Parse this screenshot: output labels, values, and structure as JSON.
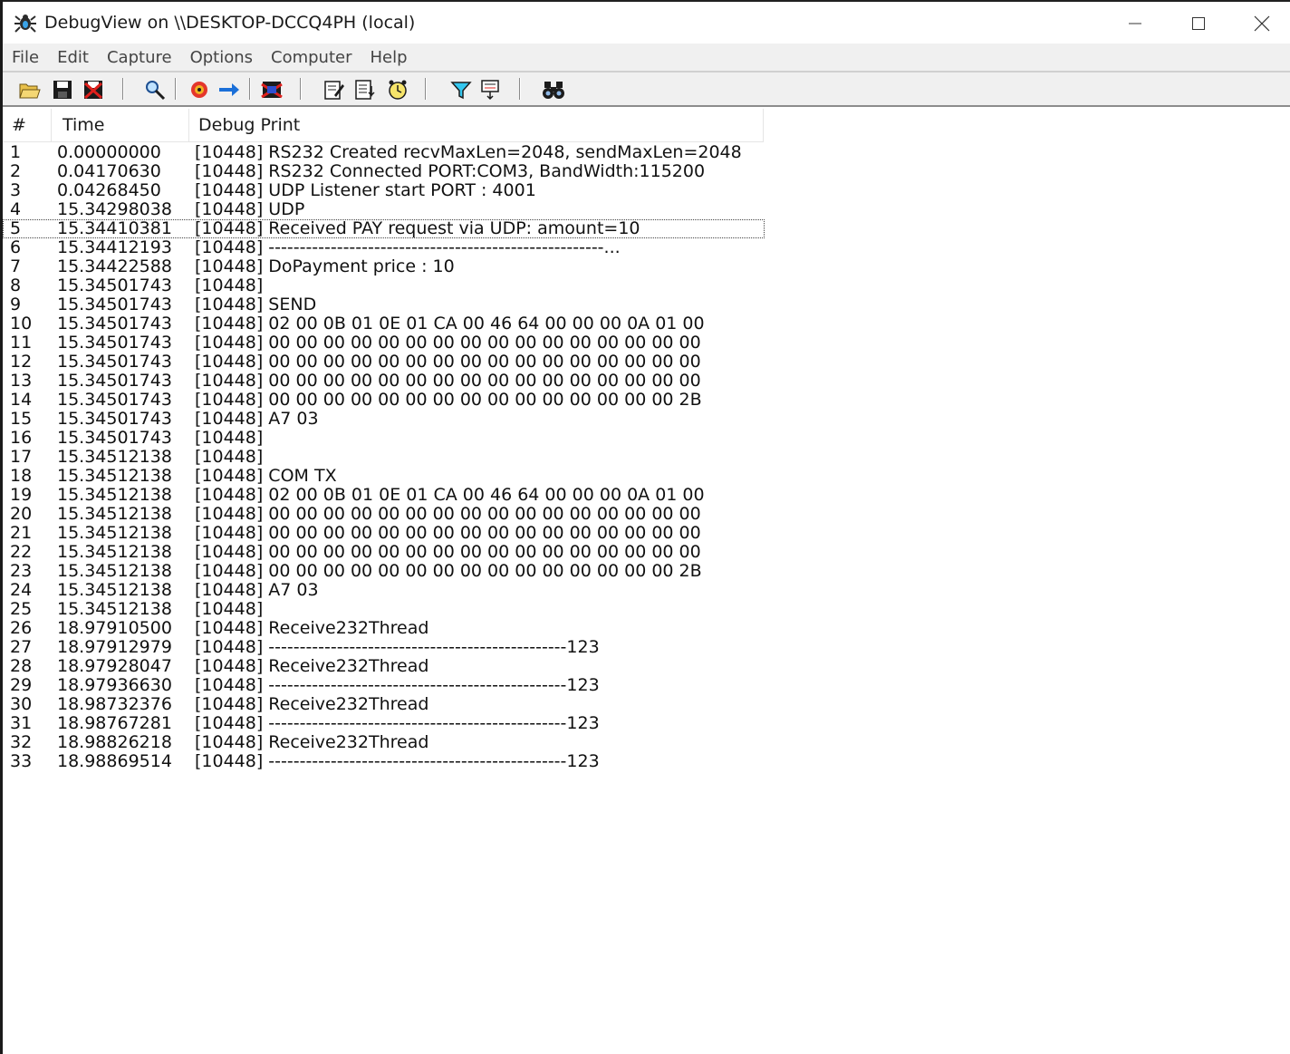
{
  "window": {
    "title": "DebugView on \\\\DESKTOP-DCCQ4PH (local)"
  },
  "menu": [
    "File",
    "Edit",
    "Capture",
    "Options",
    "Computer",
    "Help"
  ],
  "columns": {
    "num": "#",
    "time": "Time",
    "debug": "Debug Print"
  },
  "toolbar_icons": [
    "open-icon",
    "save-icon",
    "clear-icon",
    "find-icon",
    "capture-icon",
    "autoscroll-icon",
    "clear-display-icon",
    "filter-icon",
    "history-icon",
    "time-icon",
    "highlight-icon",
    "bookmark-icon",
    "binoculars-icon"
  ],
  "selected_row": 5,
  "rows": [
    {
      "n": "1",
      "t": "0.00000000",
      "m": "[10448] RS232 Created recvMaxLen=2048, sendMaxLen=2048"
    },
    {
      "n": "2",
      "t": "0.04170630",
      "m": "[10448] RS232 Connected PORT:COM3, BandWidth:115200"
    },
    {
      "n": "3",
      "t": "0.04268450",
      "m": "[10448] UDP Listener start PORT : 4001"
    },
    {
      "n": "4",
      "t": "15.34298038",
      "m": "[10448] UDP"
    },
    {
      "n": "5",
      "t": "15.34410381",
      "m": "[10448] Received PAY request via UDP: amount=10"
    },
    {
      "n": "6",
      "t": "15.34412193",
      "m": "[10448] ------------------------------------------------------..."
    },
    {
      "n": "7",
      "t": "15.34422588",
      "m": "[10448] DoPayment price : 10"
    },
    {
      "n": "8",
      "t": "15.34501743",
      "m": "[10448]"
    },
    {
      "n": "9",
      "t": "15.34501743",
      "m": "[10448] SEND"
    },
    {
      "n": "10",
      "t": "15.34501743",
      "m": "[10448] 02 00 0B 01 0E 01 CA 00   46 64 00 00 00 0A 01 00"
    },
    {
      "n": "11",
      "t": "15.34501743",
      "m": "[10448] 00 00 00 00 00 00 00 00   00 00 00 00 00 00 00 00"
    },
    {
      "n": "12",
      "t": "15.34501743",
      "m": "[10448] 00 00 00 00 00 00 00 00   00 00 00 00 00 00 00 00"
    },
    {
      "n": "13",
      "t": "15.34501743",
      "m": "[10448] 00 00 00 00 00 00 00 00   00 00 00 00 00 00 00 00"
    },
    {
      "n": "14",
      "t": "15.34501743",
      "m": "[10448] 00 00 00 00 00 00 00 00   00 00 00 00 00 00 00 2B"
    },
    {
      "n": "15",
      "t": "15.34501743",
      "m": "[10448] A7 03"
    },
    {
      "n": "16",
      "t": "15.34501743",
      "m": "[10448]"
    },
    {
      "n": "17",
      "t": "15.34512138",
      "m": "[10448]"
    },
    {
      "n": "18",
      "t": "15.34512138",
      "m": "[10448] COM TX"
    },
    {
      "n": "19",
      "t": "15.34512138",
      "m": "[10448] 02 00 0B 01 0E 01 CA 00   46 64 00 00 00 0A 01 00"
    },
    {
      "n": "20",
      "t": "15.34512138",
      "m": "[10448] 00 00 00 00 00 00 00 00   00 00 00 00 00 00 00 00"
    },
    {
      "n": "21",
      "t": "15.34512138",
      "m": "[10448] 00 00 00 00 00 00 00 00   00 00 00 00 00 00 00 00"
    },
    {
      "n": "22",
      "t": "15.34512138",
      "m": "[10448] 00 00 00 00 00 00 00 00   00 00 00 00 00 00 00 00"
    },
    {
      "n": "23",
      "t": "15.34512138",
      "m": "[10448] 00 00 00 00 00 00 00 00   00 00 00 00 00 00 00 2B"
    },
    {
      "n": "24",
      "t": "15.34512138",
      "m": "[10448] A7 03"
    },
    {
      "n": "25",
      "t": "15.34512138",
      "m": "[10448]"
    },
    {
      "n": "26",
      "t": "18.97910500",
      "m": "[10448] Receive232Thread"
    },
    {
      "n": "27",
      "t": "18.97912979",
      "m": "[10448] ------------------------------------------------123"
    },
    {
      "n": "28",
      "t": "18.97928047",
      "m": "[10448] Receive232Thread"
    },
    {
      "n": "29",
      "t": "18.97936630",
      "m": "[10448] ------------------------------------------------123"
    },
    {
      "n": "30",
      "t": "18.98732376",
      "m": "[10448] Receive232Thread"
    },
    {
      "n": "31",
      "t": "18.98767281",
      "m": "[10448] ------------------------------------------------123"
    },
    {
      "n": "32",
      "t": "18.98826218",
      "m": "[10448] Receive232Thread"
    },
    {
      "n": "33",
      "t": "18.98869514",
      "m": "[10448] ------------------------------------------------123"
    }
  ]
}
